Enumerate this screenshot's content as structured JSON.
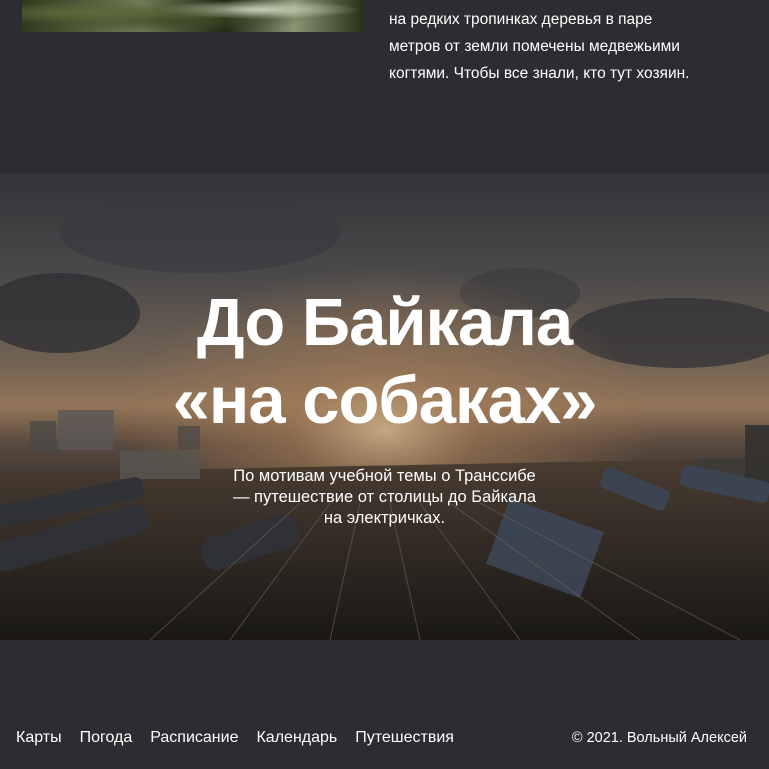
{
  "article": {
    "paragraph_cut_line": "",
    "paragraph_lines": [
      "на редких тропинках деревья в паре",
      "метров от земли помечены медвежьими",
      "когтями. Чтобы все знали, кто тут хозяин."
    ]
  },
  "hero": {
    "title_line1": "До Байкала",
    "title_line2": "«на собаках»",
    "subtitle_line1": "По мотивам учебной темы о Транссибе",
    "subtitle_line2": "— путешествие от столицы до Байкала",
    "subtitle_line3": "на электричках."
  },
  "footer": {
    "nav": [
      {
        "label": "Карты"
      },
      {
        "label": "Погода"
      },
      {
        "label": "Расписание"
      },
      {
        "label": "Календарь"
      },
      {
        "label": "Путешествия"
      }
    ],
    "copyright": "© 2021. Вольный Алексей"
  },
  "colors": {
    "background": "#2c2d31",
    "text": "#ffffff"
  }
}
